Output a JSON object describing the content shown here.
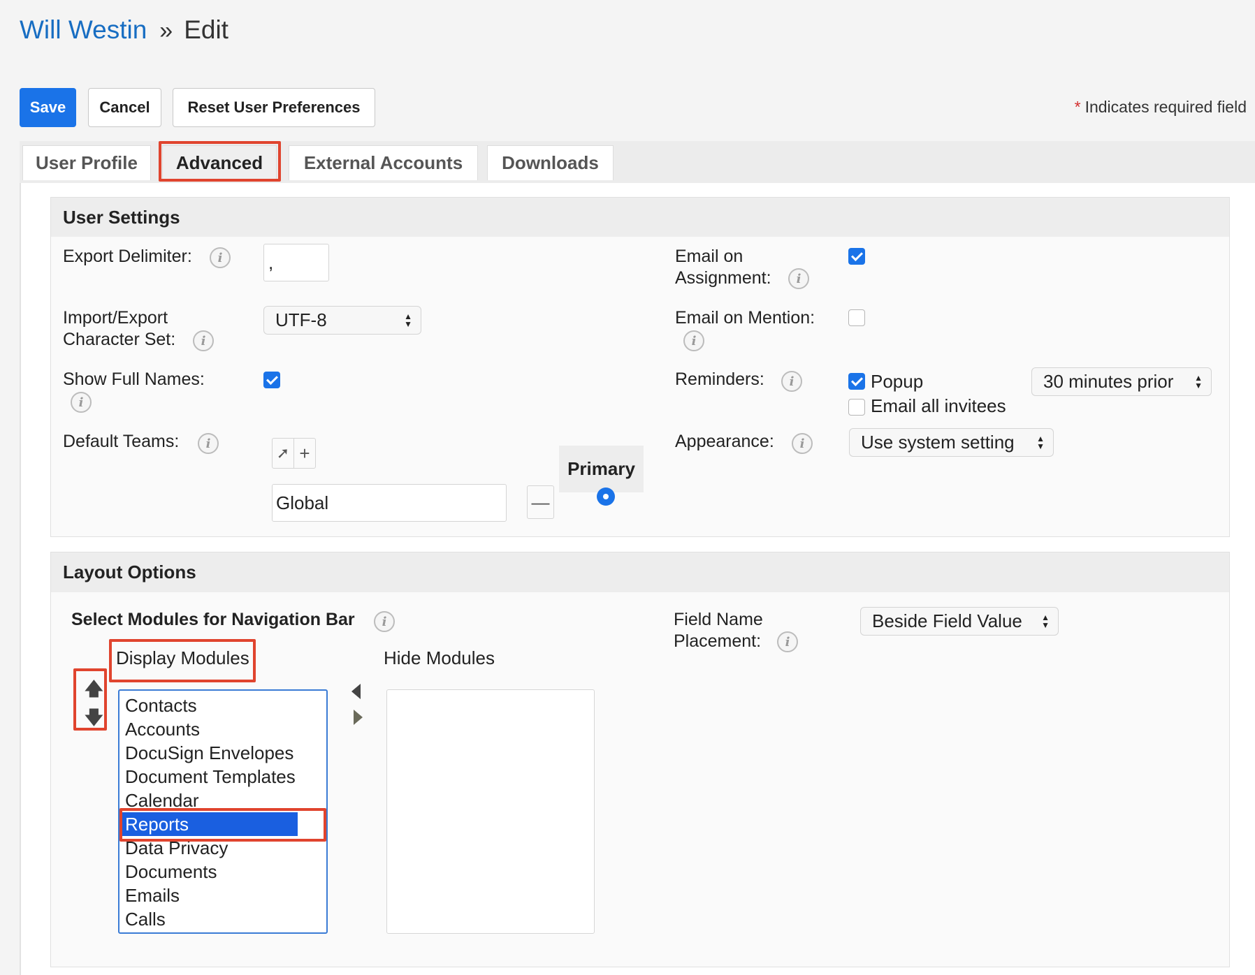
{
  "breadcrumb": {
    "record": "Will Westin",
    "separator": "»",
    "current": "Edit"
  },
  "buttons": {
    "save": "Save",
    "cancel": "Cancel",
    "reset": "Reset User Preferences"
  },
  "required_note": {
    "star": "*",
    "text": "Indicates required field"
  },
  "tabs": [
    {
      "label": "User Profile",
      "active": false
    },
    {
      "label": "Advanced",
      "active": true
    },
    {
      "label": "External Accounts",
      "active": false
    },
    {
      "label": "Downloads",
      "active": false
    }
  ],
  "user_settings": {
    "title": "User Settings",
    "export_delimiter": {
      "label": "Export Delimiter:",
      "value": ","
    },
    "charset": {
      "label_line1": "Import/Export",
      "label_line2": "Character Set:",
      "value": "UTF-8"
    },
    "show_full_names": {
      "label": "Show Full Names:",
      "checked": true
    },
    "default_teams": {
      "label": "Default Teams:",
      "primary_header": "Primary",
      "team": "Global",
      "is_primary": true
    },
    "email_on_assignment": {
      "label_line1": "Email on",
      "label_line2": "Assignment:",
      "checked": true
    },
    "email_on_mention": {
      "label": "Email on Mention:",
      "checked": false
    },
    "reminders": {
      "label": "Reminders:",
      "popup_label": "Popup",
      "popup_checked": true,
      "email_label": "Email all invitees",
      "email_checked": false,
      "timing": "30 minutes prior"
    },
    "appearance": {
      "label": "Appearance:",
      "value": "Use system setting"
    }
  },
  "layout_options": {
    "title": "Layout Options",
    "nav_bar_label": "Select Modules for Navigation Bar",
    "display_modules_label": "Display Modules",
    "hide_modules_label": "Hide Modules",
    "display_modules": [
      "Contacts",
      "Accounts",
      "DocuSign Envelopes",
      "Document Templates",
      "Calendar",
      "Reports",
      "Data Privacy",
      "Documents",
      "Emails",
      "Calls"
    ],
    "selected_module": "Reports",
    "hide_modules": [],
    "field_name_placement": {
      "label_line1": "Field Name",
      "label_line2": "Placement:",
      "value": "Beside Field Value"
    }
  },
  "colors": {
    "primary": "#1a73e8",
    "link": "#176dc2",
    "highlight": "#e0442e",
    "selection": "#1a5fe0"
  },
  "icons": {
    "info": "info-icon",
    "select_arrow": "updown-arrows-icon",
    "team_select": "cursor-arrow-icon",
    "team_add": "plus-icon",
    "team_remove": "minus-icon",
    "move_up": "arrow-up-icon",
    "move_down": "arrow-down-icon",
    "move_left": "caret-left-icon",
    "move_right": "caret-right-icon"
  }
}
